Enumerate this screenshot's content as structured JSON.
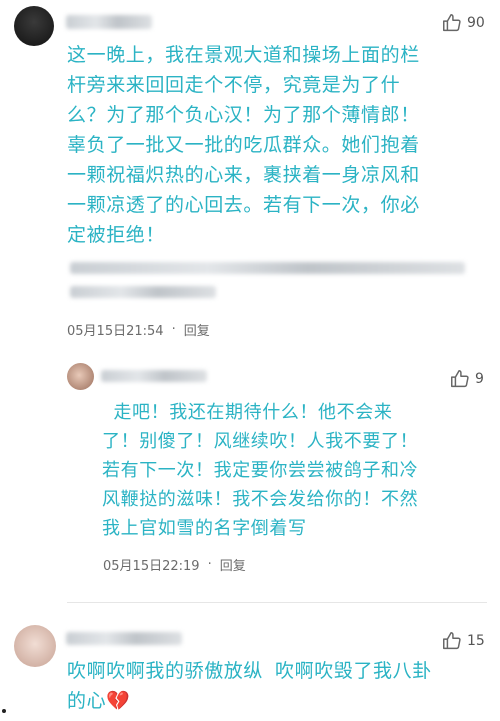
{
  "comments": [
    {
      "likes": "90",
      "text": "这一晚上，我在景观大道和操场上面的栏\n杆旁来来回回走个不停，究竟是为了什\n么？为了那个负心汉！为了那个薄情郎！\n辜负了一批又一批的吃瓜群众。她们抱着\n一颗祝福炽热的心来，裹挟着一身凉风和\n一颗凉透了的心回去。若有下一次，你必\n定被拒绝！",
      "date": "05月15日21:54",
      "reply": "回复"
    },
    {
      "likes": "9",
      "text": " 走吧！我还在期待什么！他不会来\n了！别傻了！风继续吹！人我不要了！\n若有下一次！我定要你尝尝被鸽子和冷\n风鞭挞的滋味！我不会发给你的！不然\n我上官如雪的名字倒着写",
      "date": "05月15日22:19",
      "reply": "回复"
    },
    {
      "likes": "15",
      "text": "吹啊吹啊我的骄傲放纵 吹啊吹毁了我八卦\n的心💔"
    }
  ],
  "colors": {
    "text": "#2bb3c4",
    "meta": "#6b6b6b",
    "like": "#555555"
  },
  "icons": [
    "thumbs-up-icon"
  ]
}
